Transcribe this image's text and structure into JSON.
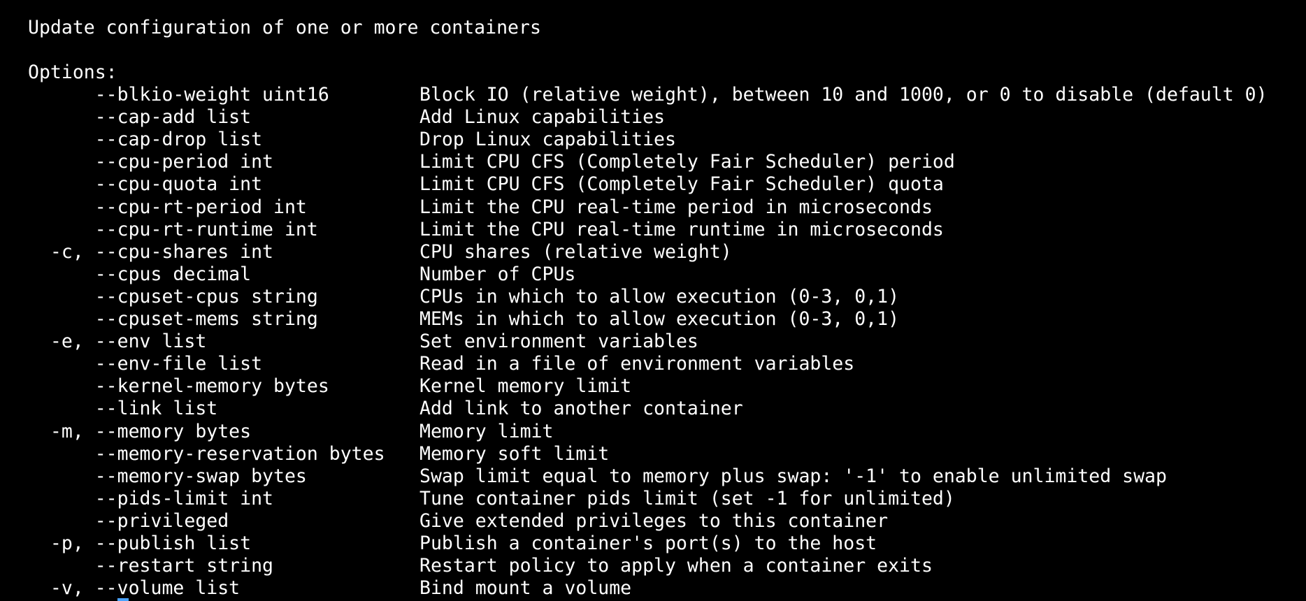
{
  "terminal": {
    "background": "#000000",
    "foreground": "#ffffff",
    "cursor_color": "#4aa3ff",
    "title_line": "Update configuration of one or more containers",
    "options_header": "Options:",
    "options": [
      {
        "flag": "      --blkio-weight uint16",
        "desc": "Block IO (relative weight), between 10 and 1000, or 0 to disable (default 0)"
      },
      {
        "flag": "      --cap-add list",
        "desc": "Add Linux capabilities"
      },
      {
        "flag": "      --cap-drop list",
        "desc": "Drop Linux capabilities"
      },
      {
        "flag": "      --cpu-period int",
        "desc": "Limit CPU CFS (Completely Fair Scheduler) period"
      },
      {
        "flag": "      --cpu-quota int",
        "desc": "Limit CPU CFS (Completely Fair Scheduler) quota"
      },
      {
        "flag": "      --cpu-rt-period int",
        "desc": "Limit the CPU real-time period in microseconds"
      },
      {
        "flag": "      --cpu-rt-runtime int",
        "desc": "Limit the CPU real-time runtime in microseconds"
      },
      {
        "flag": "  -c, --cpu-shares int",
        "desc": "CPU shares (relative weight)"
      },
      {
        "flag": "      --cpus decimal",
        "desc": "Number of CPUs"
      },
      {
        "flag": "      --cpuset-cpus string",
        "desc": "CPUs in which to allow execution (0-3, 0,1)"
      },
      {
        "flag": "      --cpuset-mems string",
        "desc": "MEMs in which to allow execution (0-3, 0,1)"
      },
      {
        "flag": "  -e, --env list",
        "desc": "Set environment variables"
      },
      {
        "flag": "      --env-file list",
        "desc": "Read in a file of environment variables"
      },
      {
        "flag": "      --kernel-memory bytes",
        "desc": "Kernel memory limit"
      },
      {
        "flag": "      --link list",
        "desc": "Add link to another container"
      },
      {
        "flag": "  -m, --memory bytes",
        "desc": "Memory limit"
      },
      {
        "flag": "      --memory-reservation bytes",
        "desc": "Memory soft limit"
      },
      {
        "flag": "      --memory-swap bytes",
        "desc": "Swap limit equal to memory plus swap: '-1' to enable unlimited swap"
      },
      {
        "flag": "      --pids-limit int",
        "desc": "Tune container pids limit (set -1 for unlimited)"
      },
      {
        "flag": "      --privileged",
        "desc": "Give extended privileges to this container"
      },
      {
        "flag": "  -p, --publish list",
        "desc": "Publish a container's port(s) to the host"
      },
      {
        "flag": "      --restart string",
        "desc": "Restart policy to apply when a container exits"
      },
      {
        "flag": "  -v, --volume list",
        "desc": "Bind mount a volume"
      }
    ]
  }
}
